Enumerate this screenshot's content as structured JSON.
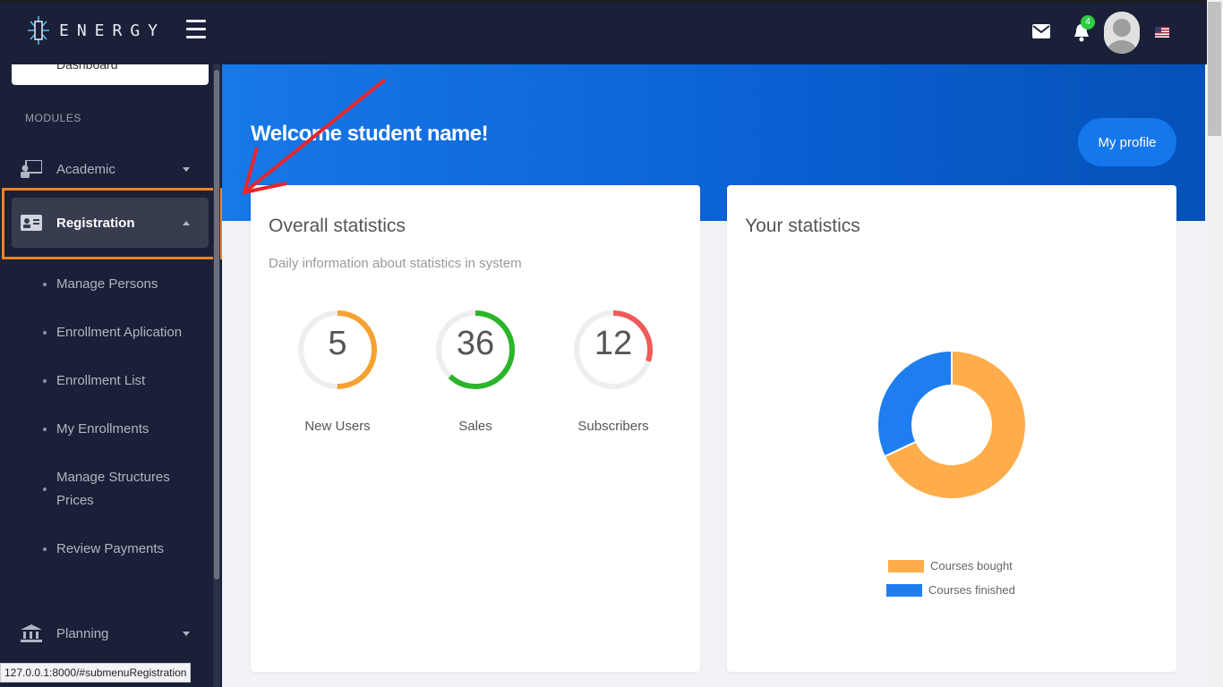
{
  "header": {
    "logo_text": "ENERGY",
    "notification_count": "4",
    "icons": [
      "menu-icon",
      "mail-icon",
      "bell-icon",
      "avatar",
      "us-flag-icon"
    ]
  },
  "sidebar": {
    "dashboard_label": "Dashboard",
    "section_label": "MODULES",
    "items": [
      {
        "label": "Academic",
        "icon": "presenter-icon",
        "state": "collapsed"
      },
      {
        "label": "Registration",
        "icon": "id-card-icon",
        "state": "expanded"
      },
      {
        "label": "Planning",
        "icon": "bank-icon",
        "state": "collapsed"
      }
    ],
    "submenu": [
      "Manage Persons",
      "Enrollment Aplication",
      "Enrollment List",
      "My Enrollments",
      "Manage Structures Prices",
      "Review Payments"
    ]
  },
  "statusbar": {
    "url": "127.0.0.1:8000/#submenuRegistration"
  },
  "hero": {
    "welcome": "Welcome student name!",
    "profile_button": "My profile"
  },
  "overall": {
    "title": "Overall statistics",
    "subtitle": "Daily information about statistics in system",
    "stats": [
      {
        "value": "5",
        "label": "New Users",
        "color": "#f8a030",
        "fraction": 0.5
      },
      {
        "value": "36",
        "label": "Sales",
        "color": "#2ab52a",
        "fraction": 0.62
      },
      {
        "value": "12",
        "label": "Subscribers",
        "color": "#f05a5a",
        "fraction": 0.3
      }
    ]
  },
  "your_stats": {
    "title": "Your statistics"
  },
  "chart_data": {
    "type": "pie",
    "donut": true,
    "categories": [
      "Courses bought",
      "Courses finished"
    ],
    "values": [
      68,
      32
    ],
    "colors": [
      "#ffad4a",
      "#1e7ef0"
    ],
    "legend_position": "bottom"
  }
}
